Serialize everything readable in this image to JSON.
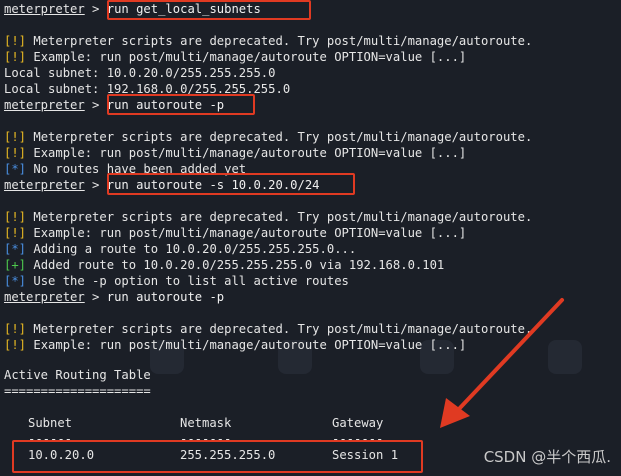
{
  "session": {
    "prompt": "meterpreter",
    "gt": " > "
  },
  "lines": [
    {
      "type": "cmd",
      "cmd": "run get_local_subnets"
    },
    {
      "type": "blank"
    },
    {
      "type": "msg",
      "tag": "[!]",
      "kind": "bang",
      "text": " Meterpreter scripts are deprecated. Try post/multi/manage/autoroute."
    },
    {
      "type": "msg",
      "tag": "[!]",
      "kind": "bang",
      "text": " Example: run post/multi/manage/autoroute OPTION=value [...]"
    },
    {
      "type": "plain",
      "text": "Local subnet: 10.0.20.0/255.255.255.0"
    },
    {
      "type": "plain",
      "text": "Local subnet: 192.168.0.0/255.255.255.0"
    },
    {
      "type": "cmd",
      "cmd": "run autoroute -p"
    },
    {
      "type": "blank"
    },
    {
      "type": "msg",
      "tag": "[!]",
      "kind": "bang",
      "text": " Meterpreter scripts are deprecated. Try post/multi/manage/autoroute."
    },
    {
      "type": "msg",
      "tag": "[!]",
      "kind": "bang",
      "text": " Example: run post/multi/manage/autoroute OPTION=value [...]"
    },
    {
      "type": "msg",
      "tag": "[*]",
      "kind": "star",
      "text": " No routes have been added yet"
    },
    {
      "type": "cmd",
      "cmd": "run autoroute -s 10.0.20.0/24"
    },
    {
      "type": "blank"
    },
    {
      "type": "msg",
      "tag": "[!]",
      "kind": "bang",
      "text": " Meterpreter scripts are deprecated. Try post/multi/manage/autoroute."
    },
    {
      "type": "msg",
      "tag": "[!]",
      "kind": "bang",
      "text": " Example: run post/multi/manage/autoroute OPTION=value [...]"
    },
    {
      "type": "msg",
      "tag": "[*]",
      "kind": "star",
      "text": " Adding a route to 10.0.20.0/255.255.255.0..."
    },
    {
      "type": "msg",
      "tag": "[+]",
      "kind": "plus",
      "text": " Added route to 10.0.20.0/255.255.255.0 via 192.168.0.101"
    },
    {
      "type": "msg",
      "tag": "[*]",
      "kind": "star",
      "text": " Use the -p option to list all active routes"
    },
    {
      "type": "cmd",
      "cmd": "run autoroute -p"
    },
    {
      "type": "blank"
    },
    {
      "type": "msg",
      "tag": "[!]",
      "kind": "bang",
      "text": " Meterpreter scripts are deprecated. Try post/multi/manage/autoroute."
    },
    {
      "type": "msg",
      "tag": "[!]",
      "kind": "bang",
      "text": " Example: run post/multi/manage/autoroute OPTION=value [...]"
    }
  ],
  "routing_table": {
    "title": "Active Routing Table",
    "rule": "====================",
    "headers": {
      "subnet": "Subnet",
      "netmask": "Netmask",
      "gateway": "Gateway"
    },
    "underline": {
      "subnet": "------",
      "netmask": "-------",
      "gateway": "-------"
    },
    "rows": [
      {
        "subnet": "10.0.20.0",
        "netmask": "255.255.255.0",
        "gateway": "Session 1"
      }
    ]
  },
  "watermark": "CSDN @半个西瓜.",
  "colors": {
    "highlight_box": "#e03a22",
    "arrow": "#e03a22",
    "bang": "#e8b923",
    "star": "#4a8fe2",
    "plus": "#4ec94e"
  }
}
